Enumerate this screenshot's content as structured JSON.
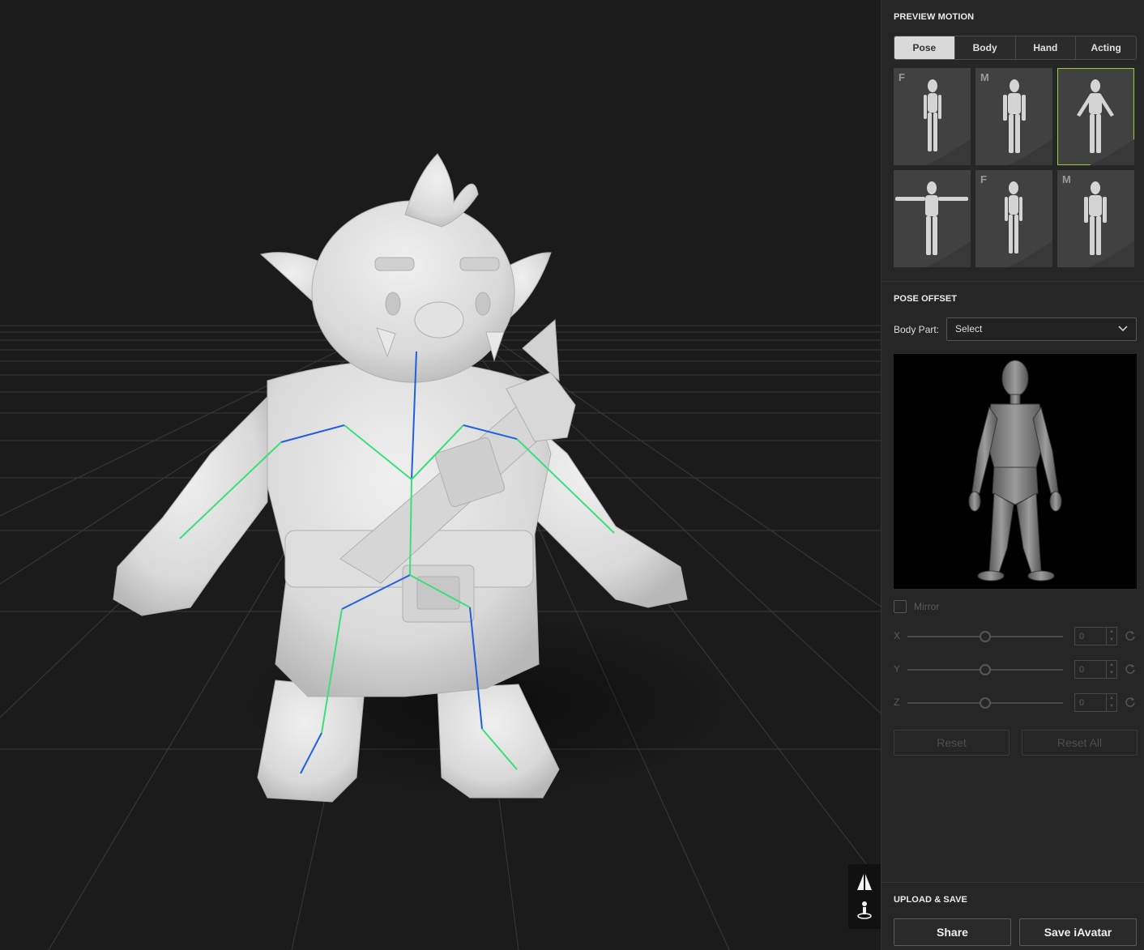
{
  "preview_motion": {
    "title": "PREVIEW MOTION",
    "tabs": [
      {
        "label": "Pose",
        "active": true
      },
      {
        "label": "Body",
        "active": false
      },
      {
        "label": "Hand",
        "active": false
      },
      {
        "label": "Acting",
        "active": false
      }
    ],
    "thumbnails": [
      {
        "tag": "F",
        "pose": "standing-female",
        "selected": false
      },
      {
        "tag": "M",
        "pose": "standing-male",
        "selected": false
      },
      {
        "tag": "",
        "pose": "a-pose",
        "selected": true
      },
      {
        "tag": "",
        "pose": "t-pose",
        "selected": false
      },
      {
        "tag": "F",
        "pose": "standing-female",
        "selected": false
      },
      {
        "tag": "M",
        "pose": "standing-male",
        "selected": false
      }
    ]
  },
  "pose_offset": {
    "title": "POSE OFFSET",
    "body_part_label": "Body Part:",
    "body_part_value": "Select",
    "mirror_label": "Mirror",
    "sliders": [
      {
        "axis": "X",
        "value": "0"
      },
      {
        "axis": "Y",
        "value": "0"
      },
      {
        "axis": "Z",
        "value": "0"
      }
    ],
    "reset_label": "Reset",
    "reset_all_label": "Reset All"
  },
  "upload_save": {
    "title": "UPLOAD & SAVE",
    "share_label": "Share",
    "save_label": "Save iAvatar"
  },
  "colors": {
    "accent_selected": "#9acd32",
    "bone_blue": "#1f5fe0",
    "bone_green": "#39e07a"
  },
  "icons": [
    "perspective-icon",
    "person-pin-icon",
    "chevron-down-icon",
    "reset-icon"
  ]
}
